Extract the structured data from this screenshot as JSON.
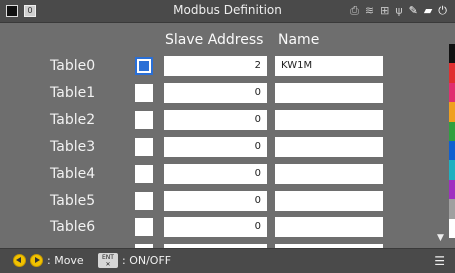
{
  "window": {
    "title": "Modbus Definition",
    "window_number": "0"
  },
  "status_icons": [
    {
      "name": "printer-icon",
      "glyph": "⎙"
    },
    {
      "name": "wifi-icon",
      "glyph": "≋"
    },
    {
      "name": "network-icon",
      "glyph": "⊞"
    },
    {
      "name": "usb-icon",
      "glyph": "ψ"
    },
    {
      "name": "tool-icon",
      "glyph": "✎"
    },
    {
      "name": "sd-card-icon",
      "glyph": "▰"
    },
    {
      "name": "plug-icon",
      "glyph": "⏻"
    }
  ],
  "headers": {
    "slave_address": "Slave Address",
    "name": "Name"
  },
  "rows": [
    {
      "label": "Table0",
      "checked": true,
      "slave_address": "2",
      "name": "KW1M"
    },
    {
      "label": "Table1",
      "checked": false,
      "slave_address": "0",
      "name": ""
    },
    {
      "label": "Table2",
      "checked": false,
      "slave_address": "0",
      "name": ""
    },
    {
      "label": "Table3",
      "checked": false,
      "slave_address": "0",
      "name": ""
    },
    {
      "label": "Table4",
      "checked": false,
      "slave_address": "0",
      "name": ""
    },
    {
      "label": "Table5",
      "checked": false,
      "slave_address": "0",
      "name": ""
    },
    {
      "label": "Table6",
      "checked": false,
      "slave_address": "0",
      "name": ""
    }
  ],
  "channel_colors": [
    "#111111",
    "#e03030",
    "#e03070",
    "#f0a020",
    "#30a040",
    "#1060d0",
    "#20b0c0",
    "#a030c0",
    "#a0a0a0",
    "#ffffff"
  ],
  "footer": {
    "move_label": ": Move",
    "ent_key": "ENT",
    "onoff_label": ": ON/OFF"
  },
  "colors": {
    "accent": "#2a6fd6",
    "nav_button": "#f2c200"
  }
}
